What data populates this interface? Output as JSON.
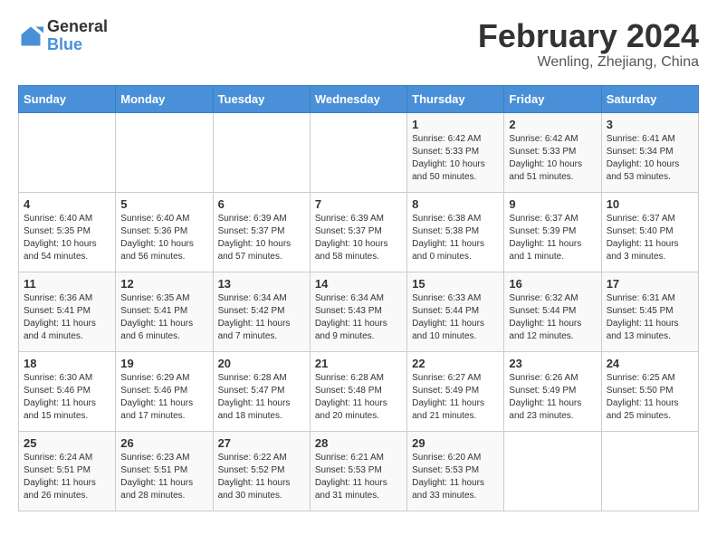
{
  "header": {
    "logo_general": "General",
    "logo_blue": "Blue",
    "title": "February 2024",
    "subtitle": "Wenling, Zhejiang, China"
  },
  "weekdays": [
    "Sunday",
    "Monday",
    "Tuesday",
    "Wednesday",
    "Thursday",
    "Friday",
    "Saturday"
  ],
  "weeks": [
    [
      {
        "day": "",
        "info": ""
      },
      {
        "day": "",
        "info": ""
      },
      {
        "day": "",
        "info": ""
      },
      {
        "day": "",
        "info": ""
      },
      {
        "day": "1",
        "info": "Sunrise: 6:42 AM\nSunset: 5:33 PM\nDaylight: 10 hours and 50 minutes."
      },
      {
        "day": "2",
        "info": "Sunrise: 6:42 AM\nSunset: 5:33 PM\nDaylight: 10 hours and 51 minutes."
      },
      {
        "day": "3",
        "info": "Sunrise: 6:41 AM\nSunset: 5:34 PM\nDaylight: 10 hours and 53 minutes."
      }
    ],
    [
      {
        "day": "4",
        "info": "Sunrise: 6:40 AM\nSunset: 5:35 PM\nDaylight: 10 hours and 54 minutes."
      },
      {
        "day": "5",
        "info": "Sunrise: 6:40 AM\nSunset: 5:36 PM\nDaylight: 10 hours and 56 minutes."
      },
      {
        "day": "6",
        "info": "Sunrise: 6:39 AM\nSunset: 5:37 PM\nDaylight: 10 hours and 57 minutes."
      },
      {
        "day": "7",
        "info": "Sunrise: 6:39 AM\nSunset: 5:37 PM\nDaylight: 10 hours and 58 minutes."
      },
      {
        "day": "8",
        "info": "Sunrise: 6:38 AM\nSunset: 5:38 PM\nDaylight: 11 hours and 0 minutes."
      },
      {
        "day": "9",
        "info": "Sunrise: 6:37 AM\nSunset: 5:39 PM\nDaylight: 11 hours and 1 minute."
      },
      {
        "day": "10",
        "info": "Sunrise: 6:37 AM\nSunset: 5:40 PM\nDaylight: 11 hours and 3 minutes."
      }
    ],
    [
      {
        "day": "11",
        "info": "Sunrise: 6:36 AM\nSunset: 5:41 PM\nDaylight: 11 hours and 4 minutes."
      },
      {
        "day": "12",
        "info": "Sunrise: 6:35 AM\nSunset: 5:41 PM\nDaylight: 11 hours and 6 minutes."
      },
      {
        "day": "13",
        "info": "Sunrise: 6:34 AM\nSunset: 5:42 PM\nDaylight: 11 hours and 7 minutes."
      },
      {
        "day": "14",
        "info": "Sunrise: 6:34 AM\nSunset: 5:43 PM\nDaylight: 11 hours and 9 minutes."
      },
      {
        "day": "15",
        "info": "Sunrise: 6:33 AM\nSunset: 5:44 PM\nDaylight: 11 hours and 10 minutes."
      },
      {
        "day": "16",
        "info": "Sunrise: 6:32 AM\nSunset: 5:44 PM\nDaylight: 11 hours and 12 minutes."
      },
      {
        "day": "17",
        "info": "Sunrise: 6:31 AM\nSunset: 5:45 PM\nDaylight: 11 hours and 13 minutes."
      }
    ],
    [
      {
        "day": "18",
        "info": "Sunrise: 6:30 AM\nSunset: 5:46 PM\nDaylight: 11 hours and 15 minutes."
      },
      {
        "day": "19",
        "info": "Sunrise: 6:29 AM\nSunset: 5:46 PM\nDaylight: 11 hours and 17 minutes."
      },
      {
        "day": "20",
        "info": "Sunrise: 6:28 AM\nSunset: 5:47 PM\nDaylight: 11 hours and 18 minutes."
      },
      {
        "day": "21",
        "info": "Sunrise: 6:28 AM\nSunset: 5:48 PM\nDaylight: 11 hours and 20 minutes."
      },
      {
        "day": "22",
        "info": "Sunrise: 6:27 AM\nSunset: 5:49 PM\nDaylight: 11 hours and 21 minutes."
      },
      {
        "day": "23",
        "info": "Sunrise: 6:26 AM\nSunset: 5:49 PM\nDaylight: 11 hours and 23 minutes."
      },
      {
        "day": "24",
        "info": "Sunrise: 6:25 AM\nSunset: 5:50 PM\nDaylight: 11 hours and 25 minutes."
      }
    ],
    [
      {
        "day": "25",
        "info": "Sunrise: 6:24 AM\nSunset: 5:51 PM\nDaylight: 11 hours and 26 minutes."
      },
      {
        "day": "26",
        "info": "Sunrise: 6:23 AM\nSunset: 5:51 PM\nDaylight: 11 hours and 28 minutes."
      },
      {
        "day": "27",
        "info": "Sunrise: 6:22 AM\nSunset: 5:52 PM\nDaylight: 11 hours and 30 minutes."
      },
      {
        "day": "28",
        "info": "Sunrise: 6:21 AM\nSunset: 5:53 PM\nDaylight: 11 hours and 31 minutes."
      },
      {
        "day": "29",
        "info": "Sunrise: 6:20 AM\nSunset: 5:53 PM\nDaylight: 11 hours and 33 minutes."
      },
      {
        "day": "",
        "info": ""
      },
      {
        "day": "",
        "info": ""
      }
    ]
  ]
}
